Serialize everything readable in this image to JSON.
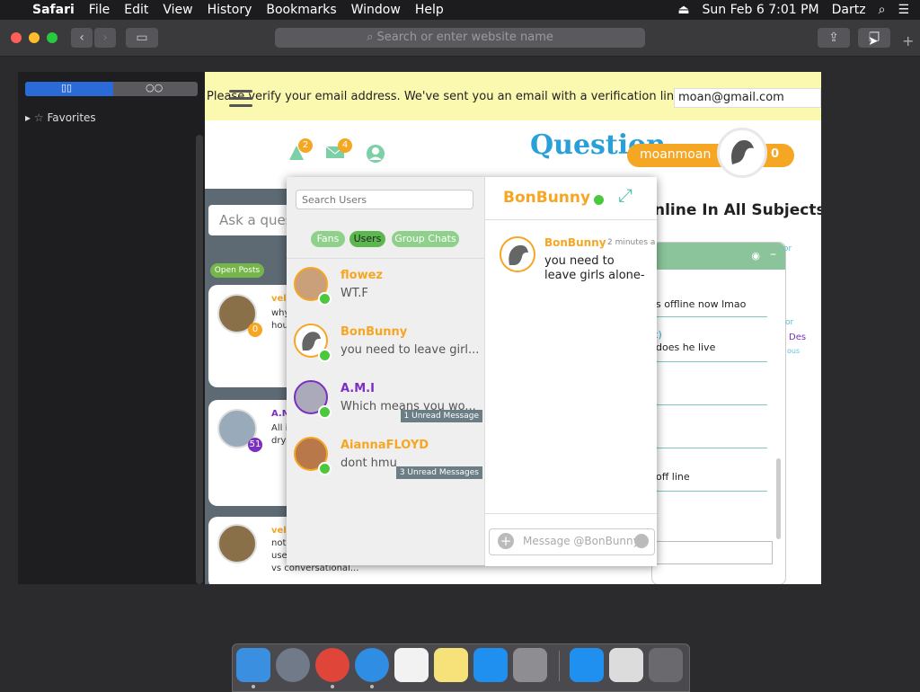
{
  "menubar": {
    "app": "Safari",
    "items": [
      "File",
      "Edit",
      "View",
      "History",
      "Bookmarks",
      "Window",
      "Help"
    ],
    "clock": "Sun Feb 6  7:01 PM",
    "user": "Dartz"
  },
  "browser": {
    "url_placeholder": "Search or enter website name"
  },
  "sidebar": {
    "favorites_label": "Favorites"
  },
  "page": {
    "verify_message": "Please verify your email address. We've sent you an email with a verification link inside.",
    "verify_email": "moan@gmail.com",
    "logo_text": "Question",
    "notifications_count": "2",
    "messages_count": "4",
    "username": "moanmoan",
    "points": "0",
    "ask_placeholder": "Ask a ques",
    "open_posts_label": "Open Posts",
    "online_heading": "nline In All Subjects",
    "feed": [
      {
        "author": "vel",
        "line1": "why",
        "line2": "hou",
        "badge": "0"
      },
      {
        "author": "A.M",
        "line1": "All i",
        "line2": "dry",
        "badge": "51"
      },
      {
        "author": "vel",
        "line1": "not",
        "line2": "use",
        "line3": "vs conversational..."
      }
    ],
    "right_panel": {
      "line1": "s offline now lmao",
      "line2": "x)",
      "line3": "does he live",
      "line4": "off line",
      "tag1": "or",
      "tag2": "or",
      "tag3": "Des",
      "tag4": "ous"
    }
  },
  "chat": {
    "search_placeholder": "Search Users",
    "tabs": [
      "Fans",
      "Users",
      "Group Chats"
    ],
    "active_tab": "Users",
    "conversations": [
      {
        "name": "flowez",
        "preview": "WT.F",
        "name_color": "#f5a623",
        "unread": ""
      },
      {
        "name": "BonBunny",
        "preview": "you need to leave girl...",
        "name_color": "#f5a623",
        "unread": ""
      },
      {
        "name": "A.M.I",
        "preview": "Which means you wo...",
        "name_color": "#7b2fc1",
        "unread": "1 Unread Message"
      },
      {
        "name": "AiannaFLOYD",
        "preview": "dont hmu",
        "name_color": "#f5a623",
        "unread": "3 Unread Messages"
      }
    ],
    "active_conversation": {
      "name": "BonBunny",
      "message": {
        "author": "BonBunny",
        "time": "2 minutes a",
        "text": "you need to leave girls alone-"
      },
      "composer_placeholder": "Message @BonBunny"
    }
  },
  "colors": {
    "accent_orange": "#f5a623",
    "online_green": "#4cc83c",
    "teal": "#4fc1b0",
    "verify_bg": "#fbf8b0"
  }
}
